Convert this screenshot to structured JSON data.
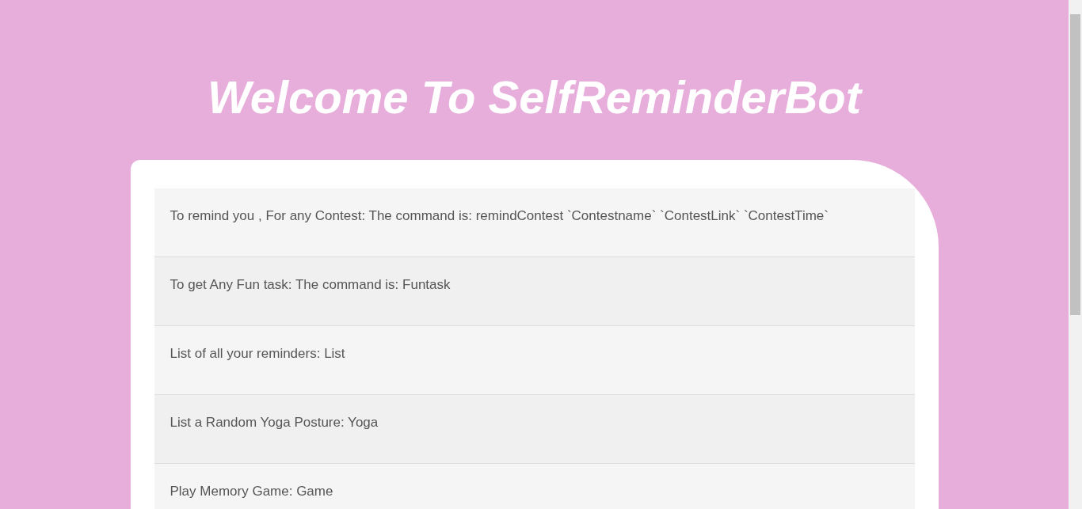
{
  "title": "Welcome To SelfReminderBot",
  "commands": [
    {
      "text": "To remind you , For any Contest: The command is: remindContest `Contestname` `ContestLink` `ContestTime`"
    },
    {
      "text": "To get Any Fun task: The command is: Funtask"
    },
    {
      "text": "List of all your reminders: List"
    },
    {
      "text": "List a Random Yoga Posture: Yoga"
    },
    {
      "text": "Play Memory Game: Game"
    }
  ]
}
